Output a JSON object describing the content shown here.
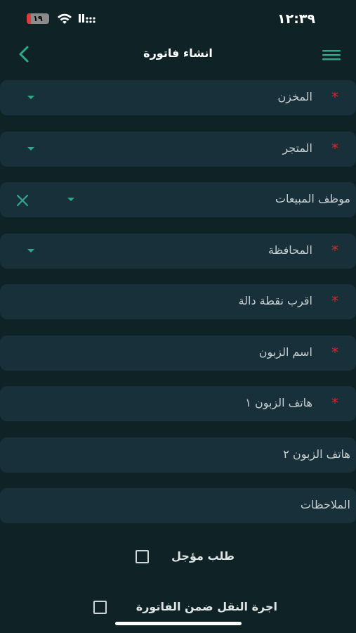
{
  "status_bar": {
    "time": "١٢:٣٩",
    "battery_text": "١٩",
    "battery_level": 0.19
  },
  "nav": {
    "title": "انشاء فاتورة"
  },
  "form": {
    "warehouse": "المخزن",
    "store": "المتجر",
    "sales_employee": "موظف المبيعات",
    "governorate": "المحافظة",
    "landmark": "اقرب نقطة دالة",
    "customer_name": "اسم الزبون",
    "customer_phone_1": "هاتف الزبون ١",
    "customer_phone_2": "هاتف الزبون ٢",
    "notes": "الملاحظات"
  },
  "options": {
    "deferred_order": "طلب مؤجل",
    "delivery_fee_included": "اجرة النقل ضمن الفاتورة"
  },
  "colors": {
    "background": "#0f2326",
    "field": "#17303a",
    "accent": "#2fa889",
    "required": "#e0202a"
  }
}
